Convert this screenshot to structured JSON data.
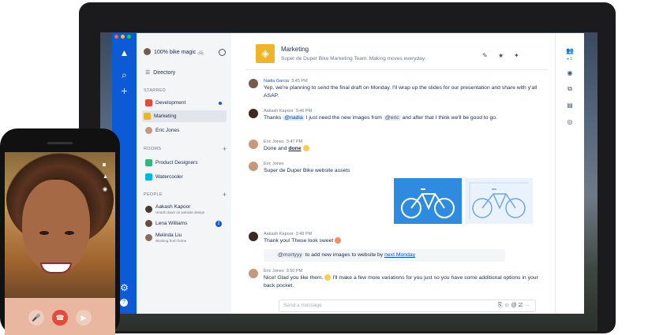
{
  "workspace": {
    "name": "100% bike magic 🚲"
  },
  "sidebar": {
    "directory": "Directory",
    "starred_header": "STARRED",
    "starred": [
      {
        "label": "Development"
      },
      {
        "label": "Marketing"
      },
      {
        "label": "Eric Jones"
      }
    ],
    "rooms_header": "ROOMS",
    "rooms": [
      {
        "label": "Product Designers"
      },
      {
        "label": "Watercooler"
      }
    ],
    "people_header": "PEOPLE",
    "people": [
      {
        "name": "Aakash Kapoor",
        "status": "Heads down on website design"
      },
      {
        "name": "Lena Williams",
        "status": "",
        "badge": "2"
      },
      {
        "name": "Melinda Liu",
        "status": "Working from home"
      }
    ]
  },
  "channel": {
    "title": "Marketing",
    "topic": "Super de Duper Bike Marketing Team. Making moves everyday."
  },
  "messages": [
    {
      "author": "Nadia Garcia",
      "time": "3:45 PM",
      "text": "Yep, we're planning to send the final draft on Monday. I'll wrap up the slides for our presentation and share with y'all ASAP."
    },
    {
      "author": "Aakash Kapoor",
      "time": "3:46 PM",
      "pre": "Thanks",
      "mention1": "@nadia",
      "mid": "I just need the new images from",
      "mention2": "@eric",
      "post": "and after that I think we'll be good to go."
    },
    {
      "author": "Eric Jones",
      "time": "3:47 PM",
      "pre": "Done and",
      "bold": "done"
    },
    {
      "author": "Eric Jones",
      "time": "",
      "text": "Super de Duper Bike website assets"
    },
    {
      "author": "Aakash Kapoor",
      "time": "3:49 PM",
      "text": "Thank you! These look sweet",
      "quote_mention": "@mortyyy",
      "quote_text": "to add new images to website by",
      "quote_link": "next Monday"
    },
    {
      "author": "Eric Jones",
      "time": "3:50 PM",
      "pre": "Nice! Glad you like them.",
      "post": "I'll make a few more variations for you just so you have some additional options in your back pocket."
    }
  ],
  "composer": {
    "placeholder": "Send a message"
  },
  "right_panel": {
    "online_count": "5"
  },
  "colors": {
    "accent": "#0c5ad6",
    "channel_logo": "#f0b429",
    "sidebar_bg": "#f4f5f7"
  }
}
